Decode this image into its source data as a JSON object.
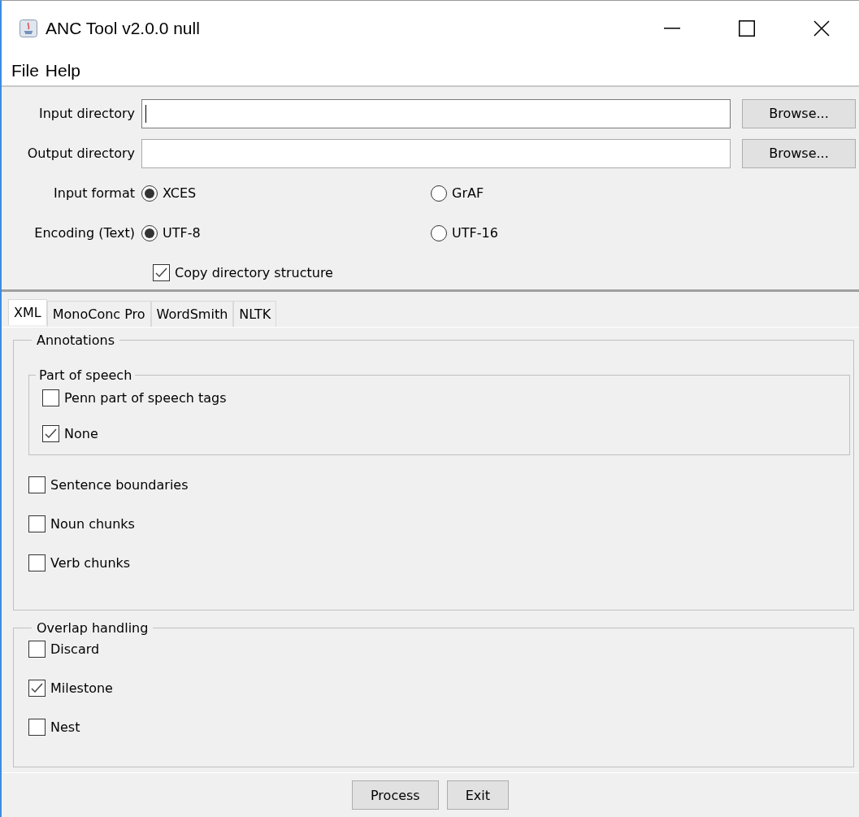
{
  "window": {
    "title": "ANC Tool v2.0.0 null"
  },
  "menu": [
    "File",
    "Help"
  ],
  "directories": [
    {
      "label": "Input directory",
      "button": "Browse...",
      "focused": true
    },
    {
      "label": "Output directory",
      "button": "Browse...",
      "focused": false
    }
  ],
  "radio_groups": [
    {
      "label": "Input format",
      "options": [
        {
          "label": "XCES",
          "selected": true
        },
        {
          "label": "GrAF",
          "selected": false
        }
      ]
    },
    {
      "label": "Encoding (Text)",
      "options": [
        {
          "label": "UTF-8",
          "selected": true
        },
        {
          "label": "UTF-16",
          "selected": false
        }
      ]
    }
  ],
  "copy_structure": {
    "label": "Copy directory structure",
    "checked": true
  },
  "tabs": [
    {
      "label": "XML",
      "selected": true
    },
    {
      "label": "MonoConc Pro",
      "selected": false
    },
    {
      "label": "WordSmith",
      "selected": false
    },
    {
      "label": "NLTK",
      "selected": false
    }
  ],
  "annotations": {
    "title": "Annotations",
    "part_of_speech": {
      "title": "Part of speech",
      "options": [
        {
          "label": "Penn part of speech tags",
          "checked": false
        },
        {
          "label": "None",
          "checked": true
        }
      ]
    },
    "options": [
      {
        "label": "Sentence boundaries",
        "checked": false
      },
      {
        "label": "Noun chunks",
        "checked": false
      },
      {
        "label": "Verb chunks",
        "checked": false
      }
    ]
  },
  "overlap": {
    "title": "Overlap handling",
    "options": [
      {
        "label": "Discard",
        "checked": false
      },
      {
        "label": "Milestone",
        "checked": true
      },
      {
        "label": "Nest",
        "checked": false
      }
    ]
  },
  "buttons": [
    "Process",
    "Exit"
  ]
}
